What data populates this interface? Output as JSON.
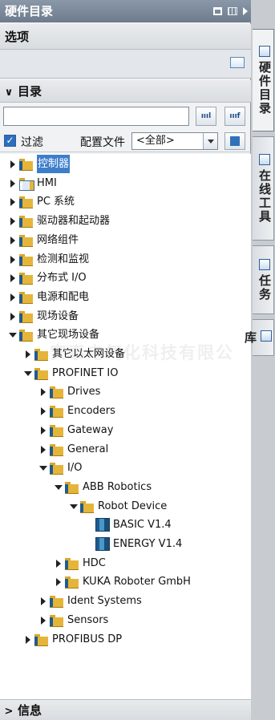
{
  "titlebar": {
    "title": "硬件目录"
  },
  "options": {
    "title": "选项"
  },
  "catalog": {
    "title": "目录",
    "search": {
      "value": "",
      "placeholder": "",
      "down_label": "ıııl",
      "up_label": "ıııf"
    },
    "filter": {
      "label": "过滤",
      "checked": true
    },
    "profile": {
      "label": "配置文件",
      "value": "<全部>"
    }
  },
  "tree": [
    {
      "label": "控制器",
      "state": "collapsed",
      "icon": "folder",
      "selected": true
    },
    {
      "label": "HMI",
      "state": "collapsed",
      "icon": "hmi-folder"
    },
    {
      "label": "PC 系统",
      "state": "collapsed",
      "icon": "folder"
    },
    {
      "label": "驱动器和起动器",
      "state": "collapsed",
      "icon": "folder"
    },
    {
      "label": "网络组件",
      "state": "collapsed",
      "icon": "folder"
    },
    {
      "label": "检测和监视",
      "state": "collapsed",
      "icon": "folder"
    },
    {
      "label": "分布式 I/O",
      "state": "collapsed",
      "icon": "folder"
    },
    {
      "label": "电源和配电",
      "state": "collapsed",
      "icon": "folder"
    },
    {
      "label": "现场设备",
      "state": "collapsed",
      "icon": "folder"
    },
    {
      "label": "其它现场设备",
      "state": "expanded",
      "icon": "folder"
    },
    {
      "label": "其它以太网设备",
      "state": "collapsed",
      "icon": "folder"
    },
    {
      "label": "PROFINET IO",
      "state": "expanded",
      "icon": "folder"
    },
    {
      "label": "Drives",
      "state": "collapsed",
      "icon": "folder"
    },
    {
      "label": "Encoders",
      "state": "collapsed",
      "icon": "folder"
    },
    {
      "label": "Gateway",
      "state": "collapsed",
      "icon": "folder"
    },
    {
      "label": "General",
      "state": "collapsed",
      "icon": "folder"
    },
    {
      "label": "I/O",
      "state": "expanded",
      "icon": "folder"
    },
    {
      "label": "ABB Robotics",
      "state": "expanded",
      "icon": "folder"
    },
    {
      "label": "Robot Device",
      "state": "expanded",
      "icon": "folder"
    },
    {
      "label": "BASIC V1.4",
      "state": "leaf",
      "icon": "module"
    },
    {
      "label": "ENERGY V1.4",
      "state": "leaf",
      "icon": "module"
    },
    {
      "label": "HDC",
      "state": "collapsed",
      "icon": "folder"
    },
    {
      "label": "KUKA Roboter GmbH",
      "state": "collapsed",
      "icon": "folder"
    },
    {
      "label": "Ident Systems",
      "state": "collapsed",
      "icon": "folder"
    },
    {
      "label": "Sensors",
      "state": "collapsed",
      "icon": "folder"
    },
    {
      "label": "PROFIBUS DP",
      "state": "collapsed",
      "icon": "folder"
    }
  ],
  "watermark": "安泰电气化科技有限公",
  "info": {
    "title": "信息"
  },
  "side_tabs": [
    {
      "label": "硬件目录",
      "icon": "catalog-icon",
      "active": true
    },
    {
      "label": "在线工具",
      "icon": "online-tools-icon",
      "active": false
    },
    {
      "label": "任务",
      "icon": "tasks-icon",
      "active": false
    },
    {
      "label": "库",
      "icon": "library-icon",
      "active": false
    }
  ]
}
